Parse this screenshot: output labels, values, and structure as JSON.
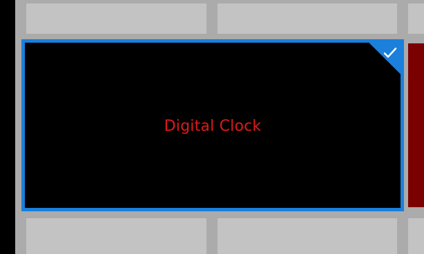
{
  "selected_tile": {
    "label": "Digital Clock",
    "accent_color": "#1b7fdc",
    "text_color": "#e01818",
    "state_icon": "check-icon"
  },
  "neighbor_tile": {
    "color": "#7b0000"
  }
}
